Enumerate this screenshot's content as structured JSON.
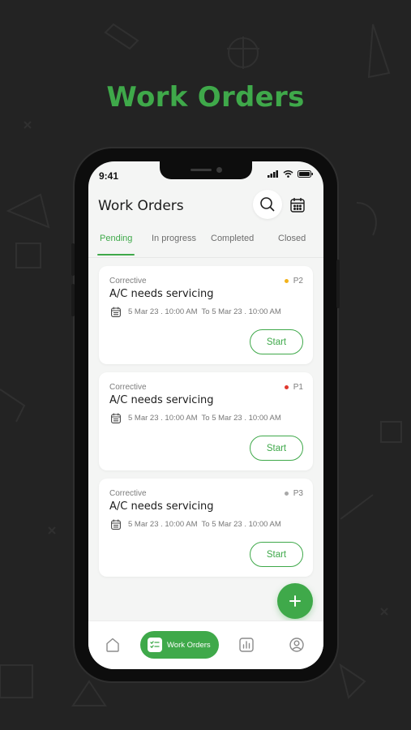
{
  "hero": {
    "title": "Work Orders"
  },
  "status_bar": {
    "time": "9:41"
  },
  "header": {
    "title": "Work Orders"
  },
  "tabs": [
    {
      "label": "Pending",
      "active": true
    },
    {
      "label": "In progress",
      "active": false
    },
    {
      "label": "Completed",
      "active": false
    },
    {
      "label": "Closed",
      "active": false
    }
  ],
  "work_orders": [
    {
      "type": "Corrective",
      "title": "A/C needs servicing",
      "priority": "P2",
      "priority_color": "#f2b21b",
      "from": "5 Mar 23 . 10:00 AM",
      "to": "To 5 Mar 23 . 10:00 AM",
      "action": "Start"
    },
    {
      "type": "Corrective",
      "title": "A/C needs servicing",
      "priority": "P1",
      "priority_color": "#e0382e",
      "from": "5 Mar 23 . 10:00 AM",
      "to": "To 5 Mar 23 . 10:00 AM",
      "action": "Start"
    },
    {
      "type": "Corrective",
      "title": "A/C needs servicing",
      "priority": "P3",
      "priority_color": "#a8a8a8",
      "from": "5 Mar 23 . 10:00 AM",
      "to": "To 5 Mar 23 . 10:00 AM",
      "action": "Start"
    }
  ],
  "bottom_nav": {
    "items": [
      {
        "icon": "home-icon"
      },
      {
        "icon": "work-orders-icon",
        "label": "Work Orders",
        "active": true
      },
      {
        "icon": "analytics-icon"
      },
      {
        "icon": "profile-icon"
      }
    ]
  },
  "colors": {
    "accent": "#3fa94a",
    "background": "#232323"
  }
}
